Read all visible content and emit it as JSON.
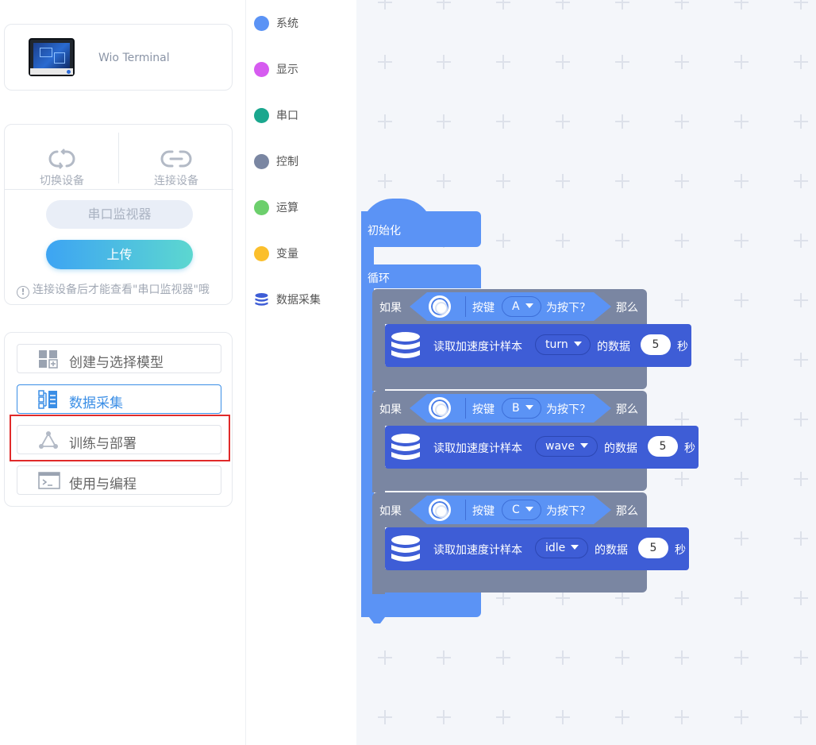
{
  "device": {
    "name": "Wio Terminal"
  },
  "actions": {
    "switch_label": "切换设备",
    "connect_label": "连接设备",
    "serial_monitor": "串口监视器",
    "upload": "上传",
    "hint": "连接设备后才能查看\"串口监视器\"哦"
  },
  "menu": [
    {
      "label": "创建与选择模型",
      "icon": "model-grid-icon"
    },
    {
      "label": "数据采集",
      "icon": "data-collection-icon",
      "active": true
    },
    {
      "label": "训练与部署",
      "icon": "train-network-icon",
      "highlighted": true
    },
    {
      "label": "使用与编程",
      "icon": "terminal-icon"
    }
  ],
  "categories": [
    {
      "label": "系统",
      "color": "#5b93f5"
    },
    {
      "label": "显示",
      "color": "#d65bf0"
    },
    {
      "label": "串口",
      "color": "#1aa78e"
    },
    {
      "label": "控制",
      "color": "#7a86a2"
    },
    {
      "label": "运算",
      "color": "#6ccf6c"
    },
    {
      "label": "变量",
      "color": "#fbbf2c"
    },
    {
      "label": "数据采集",
      "color": "#3e5dd6"
    }
  ],
  "blocks": {
    "init_label": "初始化",
    "loop_label": "循环",
    "if_label": "如果",
    "button_label": "按键",
    "pressed_label": "为按下？",
    "then_label": "那么",
    "read_label": "读取加速度计样本",
    "data_label": "的数据",
    "sec_label": "秒",
    "conditions": [
      {
        "key": "A",
        "sample": "turn",
        "seconds": "5"
      },
      {
        "key": "B",
        "sample": "wave",
        "seconds": "5"
      },
      {
        "key": "C",
        "sample": "idle",
        "seconds": "5"
      }
    ]
  }
}
